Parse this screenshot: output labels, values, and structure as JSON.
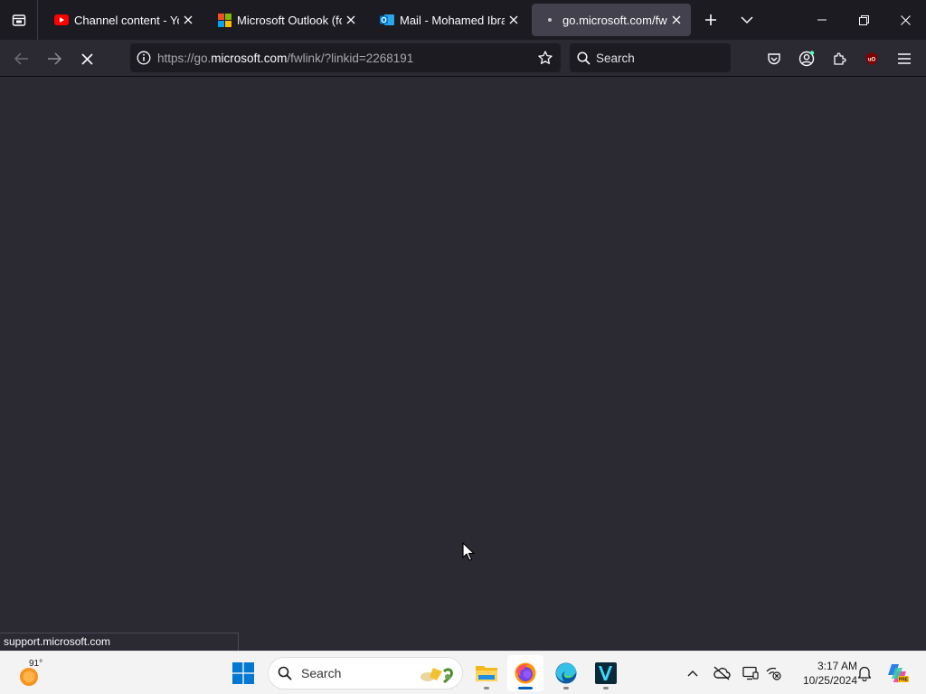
{
  "browser": {
    "tabs": [
      {
        "title": "Channel content - YouTube",
        "icon": "youtube-icon",
        "active": false
      },
      {
        "title": "Microsoft Outlook (formerly Hotmail)",
        "icon": "microsoft-logo-icon",
        "active": false
      },
      {
        "title": "Mail - Mohamed Ibrahim - Outlook",
        "icon": "outlook-icon",
        "active": false
      },
      {
        "title": "go.microsoft.com/fwlink",
        "icon": "loading-dot-icon",
        "active": true
      }
    ],
    "url": {
      "prefix": "https://go.",
      "host": "microsoft.com",
      "path": "/fwlink/?linkid=2268191"
    },
    "search_placeholder": "Search",
    "status_text": "support.microsoft.com"
  },
  "taskbar": {
    "weather_temp": "91°",
    "search_placeholder": "Search",
    "clock_time": "3:17 AM",
    "clock_date": "10/25/2024"
  },
  "colors": {
    "content_bg": "#2b2a33",
    "tabbar_bg": "#1c1b22",
    "youtube_red": "#ff0000",
    "outlook_blue": "#0078d4",
    "taskbar_bg": "#f3f3f3"
  }
}
